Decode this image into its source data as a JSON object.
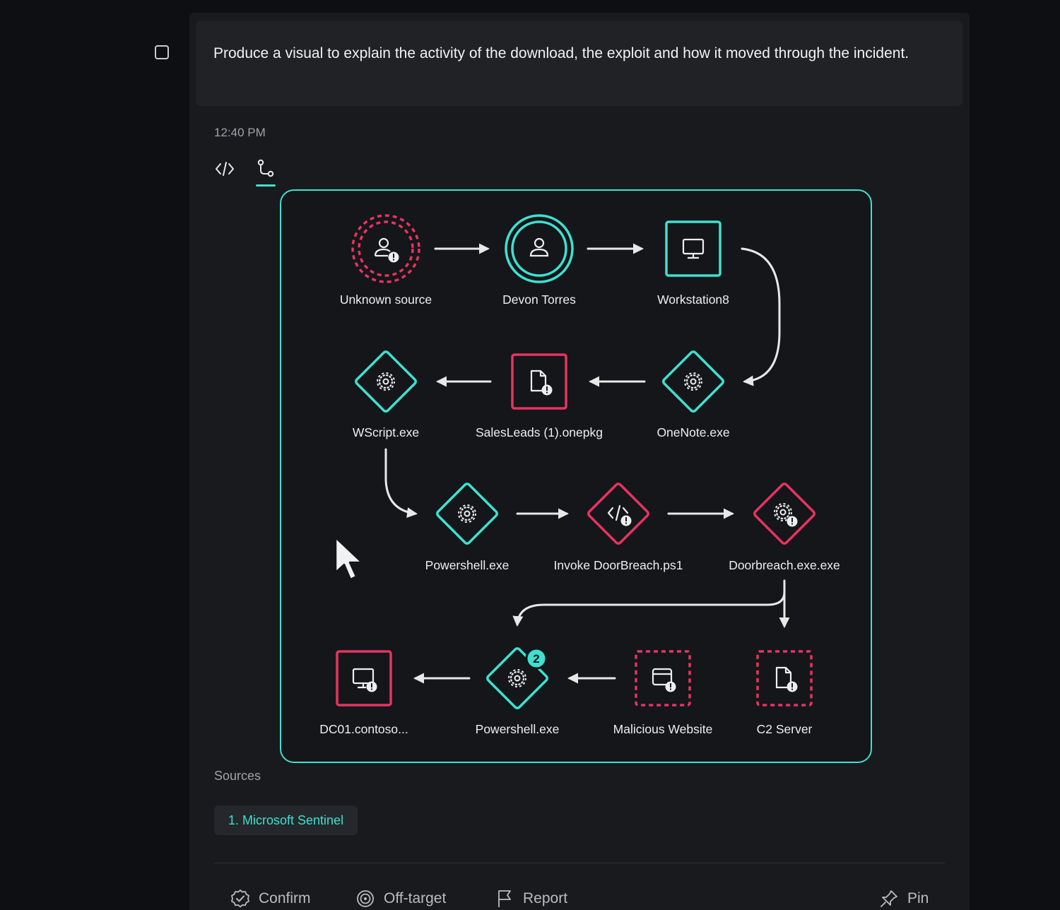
{
  "prompt": {
    "text": "Produce a visual to explain the activity of the download, the exploit and how it moved through the incident."
  },
  "response": {
    "timestamp": "12:40 PM",
    "view_tabs": [
      {
        "name": "code-view",
        "icon": "code-icon",
        "active": false
      },
      {
        "name": "graph-view",
        "icon": "flow-graph-icon",
        "active": true
      }
    ]
  },
  "graph": {
    "nodes": [
      {
        "id": "unknown-source",
        "label": "Unknown source",
        "shape": "circle-dashed",
        "icon": "user-alert-icon",
        "status": "malicious"
      },
      {
        "id": "devon-torres",
        "label": "Devon Torres",
        "shape": "circle",
        "icon": "user-icon",
        "status": "normal"
      },
      {
        "id": "workstation8",
        "label": "Workstation8",
        "shape": "square",
        "icon": "monitor-icon",
        "status": "normal"
      },
      {
        "id": "onenote",
        "label": "OneNote.exe",
        "shape": "diamond",
        "icon": "gear-icon",
        "status": "normal"
      },
      {
        "id": "salesleads",
        "label": "SalesLeads (1).onepkg",
        "shape": "square",
        "icon": "file-alert-icon",
        "status": "malicious"
      },
      {
        "id": "wscript",
        "label": "WScript.exe",
        "shape": "diamond",
        "icon": "gear-icon",
        "status": "normal"
      },
      {
        "id": "powershell-1",
        "label": "Powershell.exe",
        "shape": "diamond",
        "icon": "gear-icon",
        "status": "normal"
      },
      {
        "id": "invoke-doorbreach",
        "label": "Invoke DoorBreach.ps1",
        "shape": "diamond",
        "icon": "code-alert-icon",
        "status": "malicious"
      },
      {
        "id": "doorbreach-exe",
        "label": "Doorbreach.exe.exe",
        "shape": "diamond",
        "icon": "gear-alert-icon",
        "status": "malicious"
      },
      {
        "id": "c2-server",
        "label": "C2 Server",
        "shape": "square-dashed",
        "icon": "file-alert-icon",
        "status": "malicious"
      },
      {
        "id": "malicious-website",
        "label": "Malicious Website",
        "shape": "square-dashed",
        "icon": "browser-alert-icon",
        "status": "malicious"
      },
      {
        "id": "powershell-2",
        "label": "Powershell.exe",
        "shape": "diamond",
        "icon": "gear-icon",
        "status": "normal",
        "badge": "2"
      },
      {
        "id": "dc01",
        "label": "DC01.contoso...",
        "shape": "square",
        "icon": "monitor-alert-icon",
        "status": "malicious"
      }
    ],
    "colors": {
      "normal": "#3ee0d0",
      "malicious": "#e8335f",
      "edge": "#e8e8e8"
    }
  },
  "sources": {
    "label": "Sources",
    "items": [
      "1. Microsoft Sentinel"
    ]
  },
  "actions": {
    "confirm": "Confirm",
    "off_target": "Off-target",
    "report": "Report",
    "pin": "Pin"
  }
}
